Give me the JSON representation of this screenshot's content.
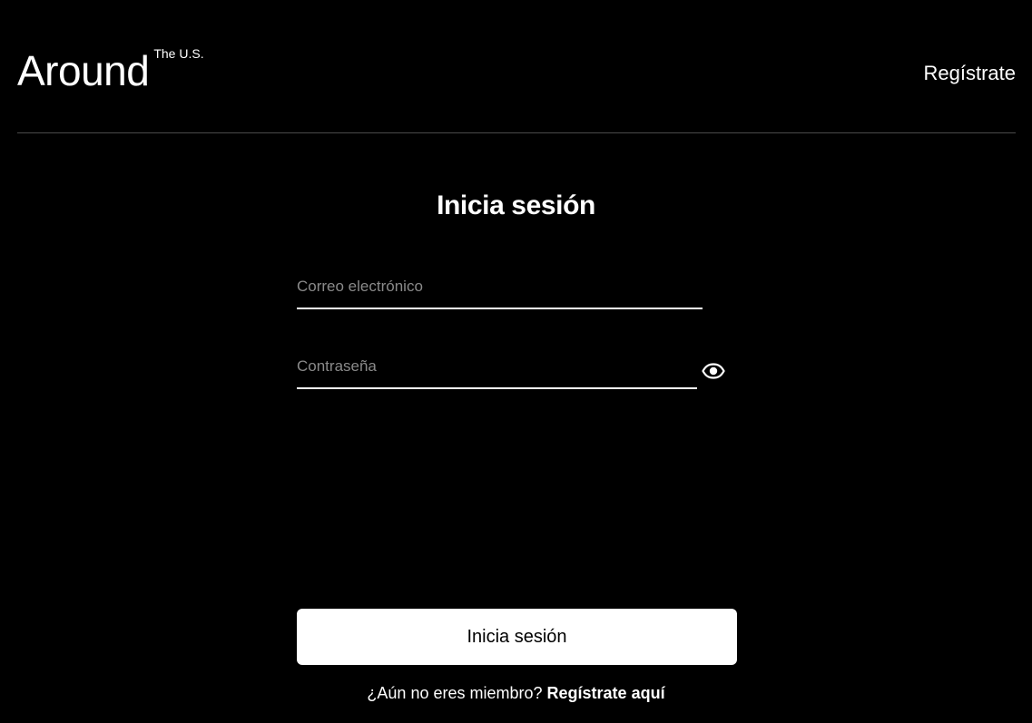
{
  "header": {
    "logo_main": "Around",
    "logo_sup": "The U.S.",
    "register_link": "Regístrate"
  },
  "form": {
    "title": "Inicia sesión",
    "email_placeholder": "Correo electrónico",
    "email_value": "",
    "password_placeholder": "Contraseña",
    "password_value": "",
    "submit_label": "Inicia sesión"
  },
  "footer": {
    "prompt": "¿Aún no eres miembro?",
    "register_link": "Regístrate aquí"
  },
  "icons": {
    "password_toggle": "eye-icon"
  }
}
